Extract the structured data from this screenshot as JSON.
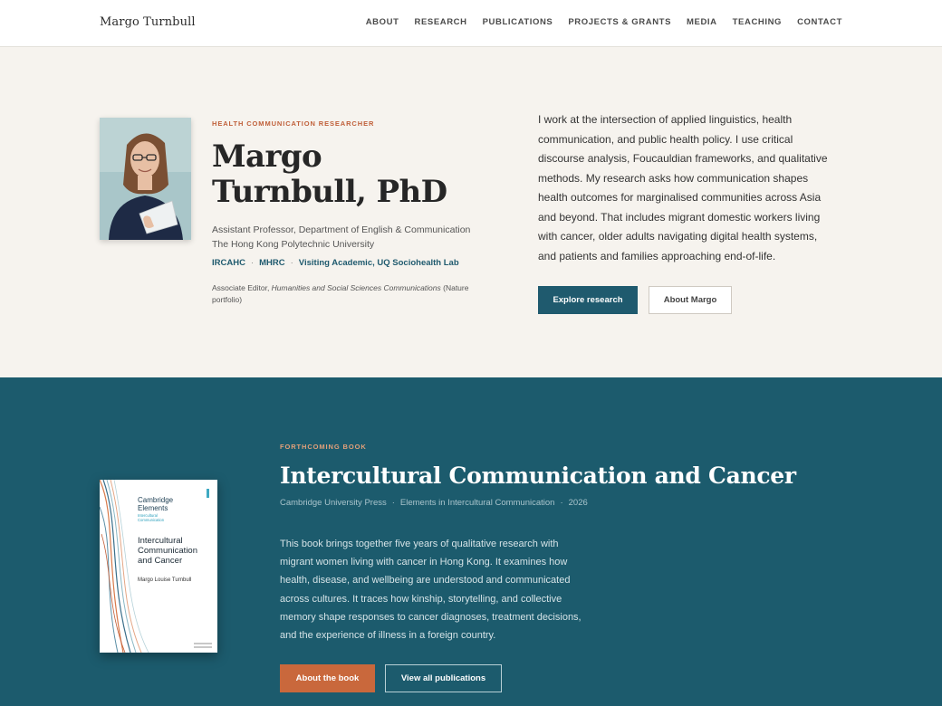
{
  "brand": "Margo Turnbull",
  "nav": [
    "ABOUT",
    "RESEARCH",
    "PUBLICATIONS",
    "PROJECTS & GRANTS",
    "MEDIA",
    "TEACHING",
    "CONTACT"
  ],
  "hero": {
    "eyebrow": "HEALTH COMMUNICATION RESEARCHER",
    "name": "Margo Turnbull, PhD",
    "role_line1": "Assistant Professor, Department of English & Communication",
    "role_line2": "The Hong Kong Polytechnic University",
    "affiliations": [
      "IRCAHC",
      "MHRC",
      "Visiting Academic, UQ Sociohealth Lab"
    ],
    "affil_separator": "·",
    "editor_prefix": "Associate Editor, ",
    "editor_journal": "Humanities and Social Sciences Communications",
    "editor_suffix": " (Nature portfolio)",
    "bio": "I work at the intersection of applied linguistics, health communication, and public health policy. I use critical discourse analysis, Foucauldian frameworks, and qualitative methods. My research asks how communication shapes health outcomes for marginalised communities across Asia and beyond. That includes migrant domestic workers living with cancer, older adults navigating digital health systems, and patients and families approaching end-of-life.",
    "primary_button": "Explore research",
    "secondary_button": "About Margo"
  },
  "book": {
    "eyebrow": "FORTHCOMING BOOK",
    "title": "Intercultural Communication and Cancer",
    "publisher": "Cambridge University Press",
    "series": "Elements in Intercultural Communication",
    "year": "2026",
    "meta_separator": "·",
    "description": "This book brings together five years of qualitative research with migrant women living with cancer in Hong Kong. It examines how health, disease, and wellbeing are understood and communicated across cultures. It traces how kinship, storytelling, and collective memory shape responses to cancer diagnoses, treatment decisions, and the experience of illness in a foreign country.",
    "primary_button": "About the book",
    "secondary_button": "View all publications",
    "cover": {
      "series_line1": "Cambridge",
      "series_line2": "Elements",
      "series_sub1": "Intercultural",
      "series_sub2": "Communication",
      "title_line1": "Intercultural",
      "title_line2": "Communication",
      "title_line3": "and Cancer",
      "author": "Margo Louise Turnbull"
    }
  },
  "colors": {
    "accent_teal": "#1f5a6e",
    "book_band": "#1c5b6d",
    "accent_orange": "#c9683c",
    "hero_bg": "#f6f3ee"
  }
}
